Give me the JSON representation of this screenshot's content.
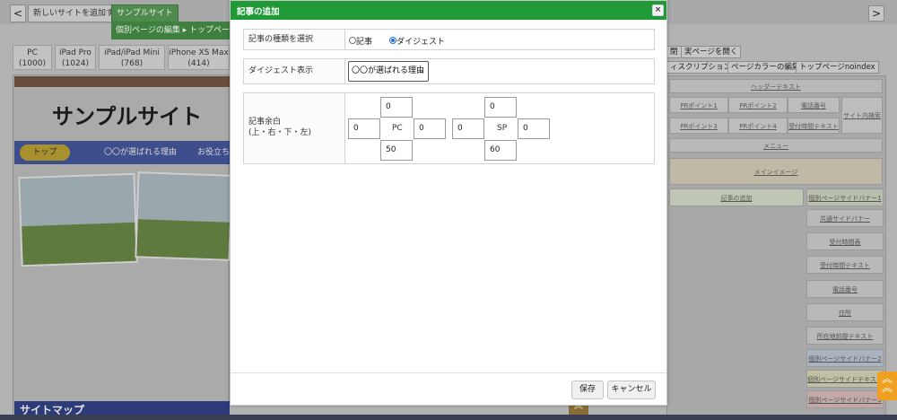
{
  "background": {
    "nav_back": "<",
    "nav_forward": ">",
    "tabs": [
      "新しいサイトを追加する",
      "サンプルサイト"
    ],
    "green_bar": "個別ページの編集 ▸ トップページ編",
    "devices": [
      {
        "name": "PC",
        "size": "(1000)"
      },
      {
        "name": "iPad Pro",
        "size": "(1024)"
      },
      {
        "name": "iPad/iPad Mini",
        "size": "(768)"
      },
      {
        "name": "iPhone XS Max",
        "size": "(414)"
      }
    ],
    "preview_title": "サンプルサイト",
    "preview_nav": [
      "トップ",
      "〇〇が選ばれる理由",
      "お役立ち"
    ],
    "sitemap": "サイトマップ",
    "right_buttons": [
      "閉",
      "実ページを開く",
      "ィスクリプション",
      "ページカラーの編集",
      "トップページnoindex"
    ],
    "right_header": "ヘッダーテキスト",
    "right_pr": [
      "PRポイント1",
      "PRポイント2",
      "電話番号",
      "PRポイント3",
      "PRポイント4",
      "受付時間テキスト"
    ],
    "right_side_label": "サイト内検索",
    "right_menu": "メニュー",
    "right_main": "メインイメージ",
    "right_add": "記事の追加",
    "right_side_items": [
      "個別ページサイドバナー1",
      "共通サイドバナー",
      "受付時間表",
      "受付時間テキスト",
      "電話番号",
      "住所",
      "所在地前提テキスト",
      "個別ページサイドバナー2",
      "個別ページサイドテキスト",
      "個別ページサイドバナー3"
    ],
    "colors": {
      "modal_header": "#1f9a36",
      "overlay": "#8a8a8a"
    }
  },
  "modal": {
    "title": "記事の追加",
    "close_icon": "×",
    "type_label": "記事の種類を選択",
    "type_options": [
      "記事",
      "ダイジェスト"
    ],
    "type_selected": "ダイジェスト",
    "digest_label": "ダイジェスト表示",
    "digest_value": "〇〇が選ばれる理由",
    "margin_label": "記事余白",
    "margin_sub": "(上・右・下・左)",
    "pc": {
      "label": "PC",
      "top": "0",
      "right": "0",
      "bottom": "50",
      "left": "0"
    },
    "sp": {
      "label": "SP",
      "top": "0",
      "right": "0",
      "bottom": "60",
      "left": "0"
    },
    "save": "保存",
    "cancel": "キャンセル"
  }
}
